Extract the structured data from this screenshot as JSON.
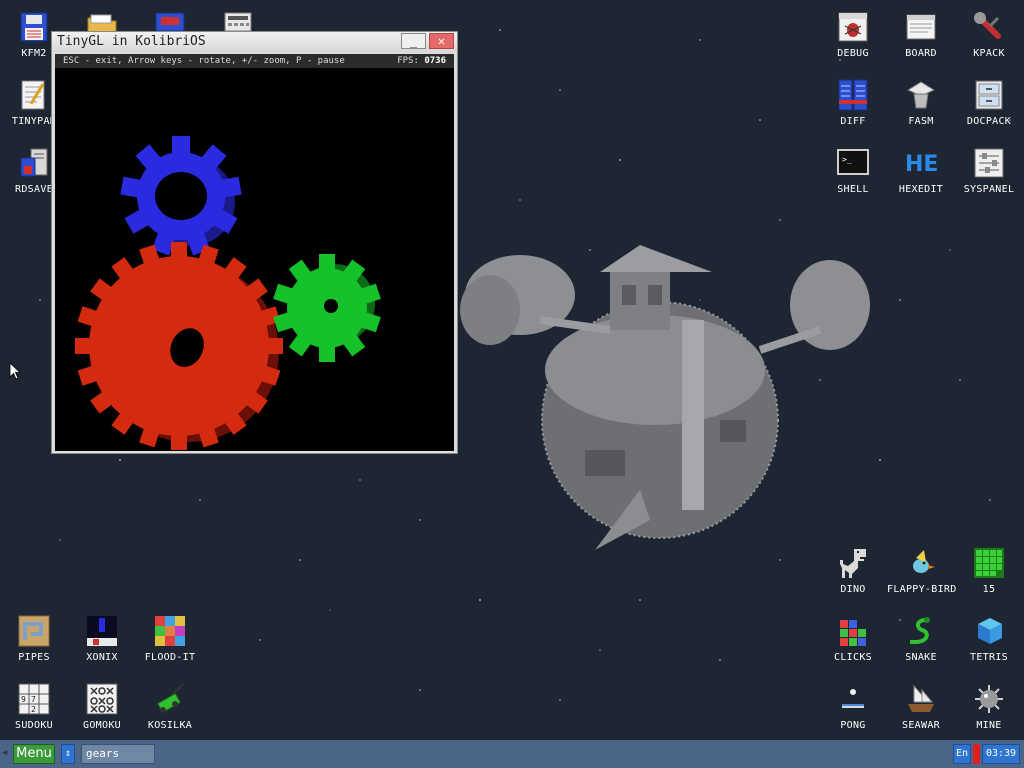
{
  "desktop_left_icons": [
    {
      "label": "KFM2",
      "icon": "floppy-disk-icon"
    },
    {
      "label": "",
      "icon": "folder-icon"
    },
    {
      "label": "",
      "icon": "screen-icon"
    },
    {
      "label": "",
      "icon": "calculator-icon"
    },
    {
      "label": "TINYPAD",
      "icon": "notepad-icon"
    },
    {
      "label": "RDSAVE",
      "icon": "ramdisk-save-icon"
    },
    {
      "label": "PIPES",
      "icon": "pipes-icon"
    },
    {
      "label": "XONIX",
      "icon": "xonix-icon"
    },
    {
      "label": "FLOOD-IT",
      "icon": "flood-it-icon"
    },
    {
      "label": "SUDOKU",
      "icon": "sudoku-icon"
    },
    {
      "label": "GOMOKU",
      "icon": "gomoku-icon"
    },
    {
      "label": "KOSILKA",
      "icon": "lawnmower-icon"
    }
  ],
  "desktop_right_icons": [
    {
      "label": "DEBUG",
      "icon": "bug-icon"
    },
    {
      "label": "BOARD",
      "icon": "board-icon"
    },
    {
      "label": "KPACK",
      "icon": "wrench-icon"
    },
    {
      "label": "DIFF",
      "icon": "diff-icon"
    },
    {
      "label": "FASM",
      "icon": "fasm-icon"
    },
    {
      "label": "DOCPACK",
      "icon": "cabinet-icon"
    },
    {
      "label": "SHELL",
      "icon": "terminal-icon"
    },
    {
      "label": "HEXEDIT",
      "icon": "hex-icon"
    },
    {
      "label": "SYSPANEL",
      "icon": "sliders-icon"
    },
    {
      "label": "DINO",
      "icon": "dino-icon"
    },
    {
      "label": "FLAPPY-BIRD",
      "icon": "bird-icon"
    },
    {
      "label": "15",
      "icon": "fifteen-puzzle-icon"
    },
    {
      "label": "CLICKS",
      "icon": "clicks-icon"
    },
    {
      "label": "SNAKE",
      "icon": "snake-icon"
    },
    {
      "label": "TETRIS",
      "icon": "tetris-icon"
    },
    {
      "label": "PONG",
      "icon": "pong-icon"
    },
    {
      "label": "SEAWAR",
      "icon": "ship-icon"
    },
    {
      "label": "MINE",
      "icon": "mine-icon"
    }
  ],
  "window": {
    "title": "TinyGL in KolibriOS",
    "minimize_glyph": "_",
    "close_glyph": "✕",
    "help_text": "ESC - exit, Arrow keys - rotate, +/- zoom, P - pause",
    "fps_label": "FPS:",
    "fps_value": "0736",
    "gear_colors": {
      "big": "#d42a10",
      "small": "#15c22a",
      "top": "#2a2ae0"
    }
  },
  "taskbar": {
    "menu_label": "Menu",
    "switch_glyph": "⇕",
    "task_label": "gears",
    "lang": "En",
    "clock": "03:39"
  },
  "colors": {
    "desktop_bg": "#1e2633",
    "taskbar": "#4a6588",
    "menu_green": "#3b9a3b",
    "accent_blue": "#2f74d0"
  }
}
